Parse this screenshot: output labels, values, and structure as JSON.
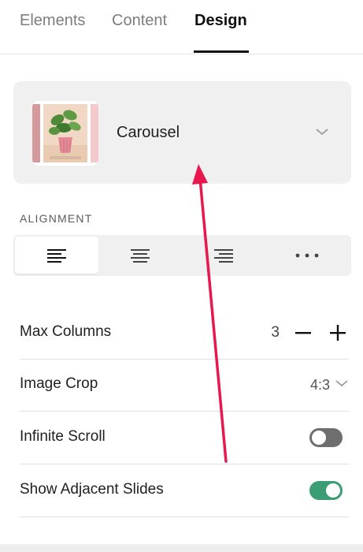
{
  "tabs": {
    "items": [
      "Elements",
      "Content",
      "Design"
    ],
    "active": "Design"
  },
  "layout": {
    "name": "Carousel",
    "thumbnail_icon": "plant-pot-thumbnail",
    "chevron_icon": "chevron-down-icon"
  },
  "alignment": {
    "label": "ALIGNMENT",
    "options": [
      "align-left-icon",
      "align-center-icon",
      "align-right-icon",
      "more-options-icon"
    ],
    "selected": "align-left-icon"
  },
  "settings": {
    "max_columns": {
      "label": "Max Columns",
      "value": "3",
      "decrement_icon": "minus-icon",
      "increment_icon": "plus-icon"
    },
    "image_crop": {
      "label": "Image Crop",
      "value": "4:3",
      "chevron_icon": "chevron-down-icon"
    },
    "infinite_scroll": {
      "label": "Infinite Scroll",
      "enabled": false
    },
    "show_adjacent_slides": {
      "label": "Show Adjacent Slides",
      "enabled": true
    }
  },
  "annotation": {
    "type": "arrow",
    "color": "#e8184f"
  },
  "colors": {
    "toggle_on": "#3b9d73",
    "toggle_off": "#6e6e6e",
    "card_bg": "#f0f0f0"
  }
}
